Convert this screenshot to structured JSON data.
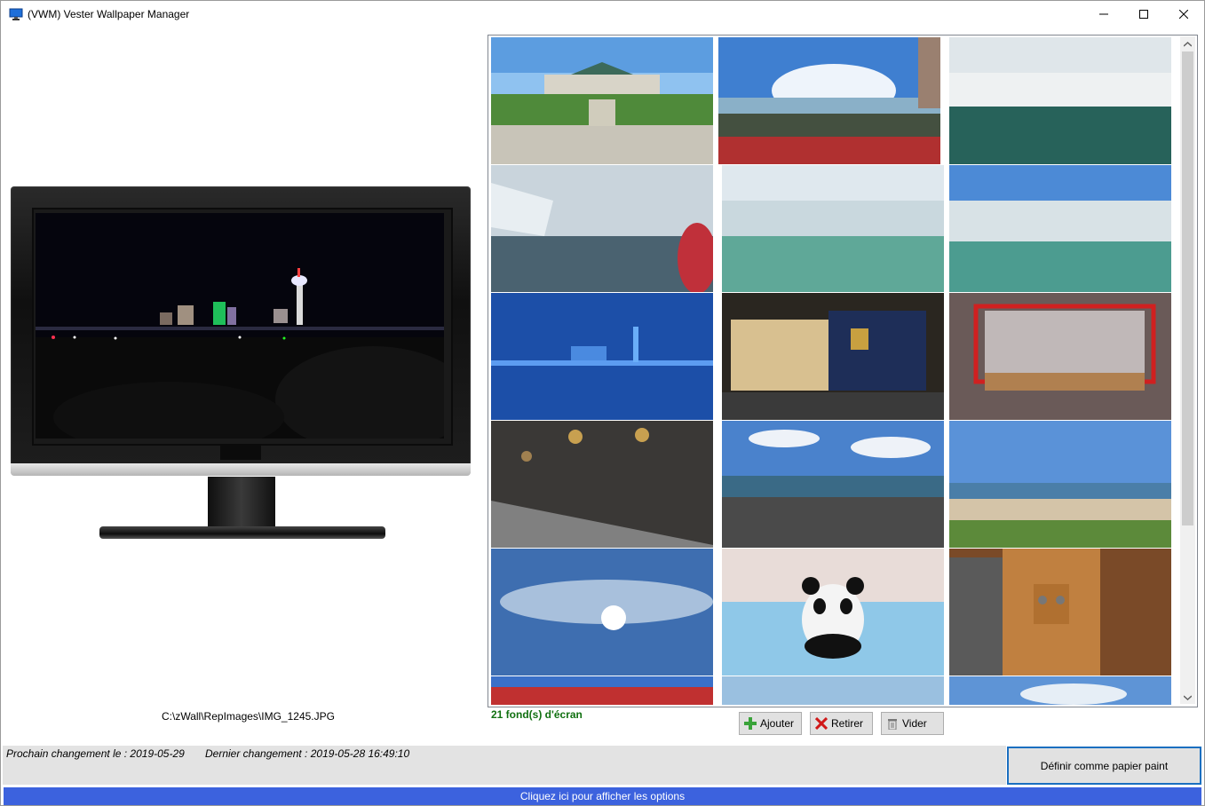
{
  "window": {
    "title": "(VWM) Vester Wallpaper Manager"
  },
  "preview": {
    "file_path": "C:\\zWall\\RepImages\\IMG_1245.JPG"
  },
  "gallery": {
    "count_label": "21 fond(s) d'écran",
    "thumbnails": [
      {
        "name": "thumb-garden-building"
      },
      {
        "name": "thumb-falls-crowd"
      },
      {
        "name": "thumb-falls-wide"
      },
      {
        "name": "thumb-falls-mist-people"
      },
      {
        "name": "thumb-falls-horseshoe"
      },
      {
        "name": "thumb-falls-horseshoe-2"
      },
      {
        "name": "thumb-night-skyline-blue"
      },
      {
        "name": "thumb-hall-of-fame"
      },
      {
        "name": "thumb-hockey-net"
      },
      {
        "name": "thumb-rings-display"
      },
      {
        "name": "thumb-city-aerial"
      },
      {
        "name": "thumb-beach"
      },
      {
        "name": "thumb-sky-sun"
      },
      {
        "name": "thumb-panda-plush"
      },
      {
        "name": "thumb-wall-telephone"
      }
    ]
  },
  "actions": {
    "add_label": "Ajouter",
    "remove_label": "Retirer",
    "clear_label": "Vider"
  },
  "status": {
    "next_change": "Prochain changement le : 2019-05-29",
    "last_change": "Dernier changement : 2019-05-28 16:49:10"
  },
  "set_wallpaper_label": "Définir comme papier paint",
  "options_bar_label": "Cliquez ici pour afficher les options",
  "colors": {
    "accent": "#3c62de",
    "count_green": "#107010",
    "focus_border": "#1a6fc0"
  }
}
